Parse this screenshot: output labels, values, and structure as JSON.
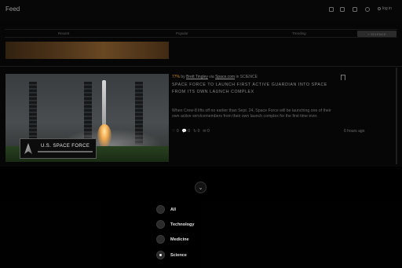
{
  "header": {
    "title": "Feed",
    "login_label": "log in",
    "icons": [
      "panel-icon",
      "grid-icon",
      "bell-icon",
      "info-icon",
      "user-icon"
    ]
  },
  "tabs": [
    {
      "label": "Recent"
    },
    {
      "label": "Popular"
    },
    {
      "label": "Trending"
    }
  ],
  "tabs_button": "+ SCIENCE",
  "article": {
    "percent": "77%",
    "by_prefix": "by",
    "author": "Brett Tingley",
    "via": "via",
    "source": "Space.com",
    "category": "in SCIENCE",
    "headline": "Space Force to launch first active Guardian into space from its own launch complex",
    "summary": "When Crew-8 lifts off no earlier than Sept. 24, Space Force will be launching one of their own active servicemembers from their own launch complex for the first time ever.",
    "actions": [
      "♡ 0",
      "💬 0",
      "↻ 0",
      "✉ 0"
    ],
    "time": "6 hours ago",
    "image_sign": "U.S. SPACE FORCE"
  },
  "filter": {
    "options": [
      {
        "label": "All",
        "selected": false
      },
      {
        "label": "Technology",
        "selected": false
      },
      {
        "label": "Medicine",
        "selected": false
      },
      {
        "label": "Science",
        "selected": true
      }
    ]
  }
}
